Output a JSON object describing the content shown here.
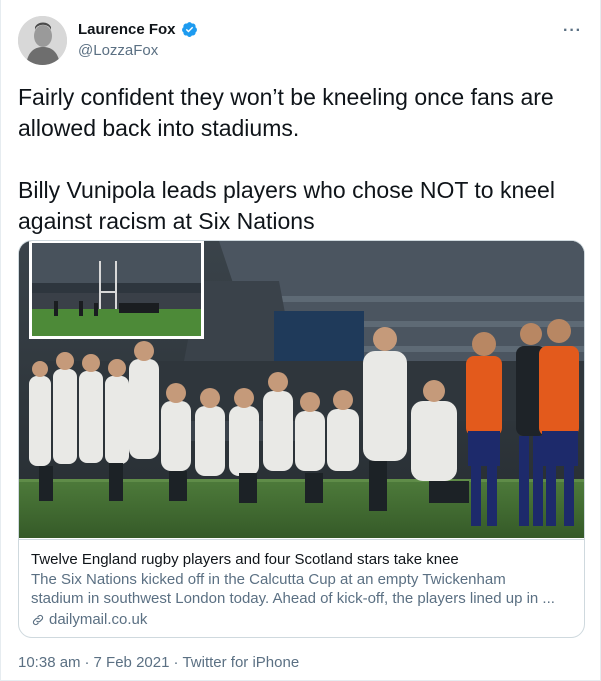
{
  "author": {
    "display_name": "Laurence Fox",
    "handle": "@LozzaFox",
    "verified": true,
    "avatar_icon": "avatar-photo"
  },
  "more_icon": "more-horizontal-icon",
  "more_label": "···",
  "tweet": {
    "line1": "Fairly confident they won’t be kneeling once fans are",
    "line2": "allowed back into stadiums.",
    "line3": "Billy Vunipola leads players who chose NOT to kneel",
    "line4": "against racism at Six Nations"
  },
  "card": {
    "title": "Twelve England rugby players and four Scotland stars take knee",
    "description_line1": "The Six Nations kicked off in the Calcutta Cup at an empty Twickenham",
    "description_line2": "stadium in southwest London today. Ahead of kick-off, the players lined up in ...",
    "domain": "dailymail.co.uk",
    "domain_icon": "link-icon"
  },
  "meta": {
    "time": "10:38 am",
    "separator1": "·",
    "date": "7 Feb 2021",
    "separator2": "·",
    "source": "Twitter for iPhone"
  },
  "colors": {
    "text": "#0f1419",
    "secondary": "#5b7083",
    "verified_blue": "#1d9bf0",
    "border": "#cfd9de"
  }
}
